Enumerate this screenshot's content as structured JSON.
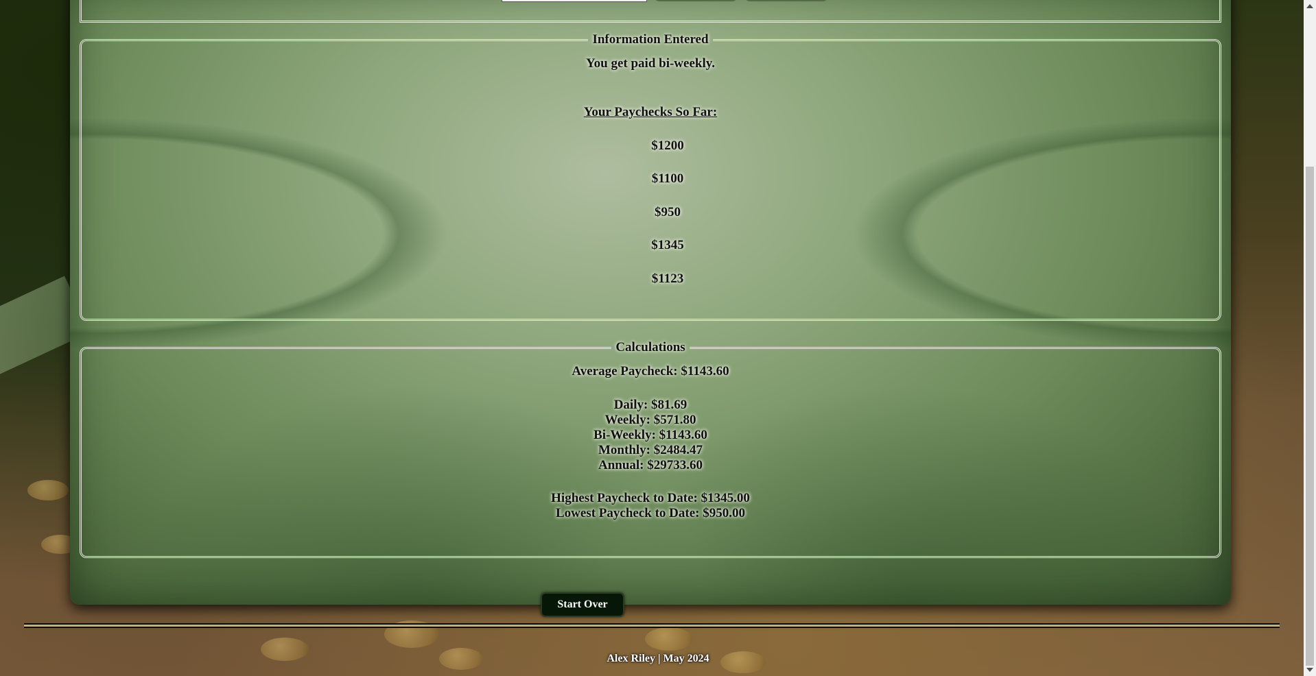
{
  "info": {
    "legend": "Information Entered",
    "frequency_text": "You get paid bi-weekly.",
    "paychecks_heading": "Your Paychecks So Far:",
    "paychecks": [
      "$1200",
      "$1100",
      "$950",
      "$1345",
      "$1123"
    ]
  },
  "calc": {
    "legend": "Calculations",
    "average": "Average Paycheck: $1143.60",
    "daily": "Daily: $81.69",
    "weekly": "Weekly: $571.80",
    "biweekly": "Bi-Weekly: $1143.60",
    "monthly": "Monthly: $2484.47",
    "annual": "Annual: $29733.60",
    "highest": "Highest Paycheck to Date: $1345.00",
    "lowest": "Lowest Paycheck to Date: $950.00"
  },
  "actions": {
    "start_over": "Start Over"
  },
  "footer": {
    "text": "Alex Riley | May 2024"
  },
  "colors": {
    "button_bg": "#061708",
    "panel_green": "#8ea77c"
  }
}
